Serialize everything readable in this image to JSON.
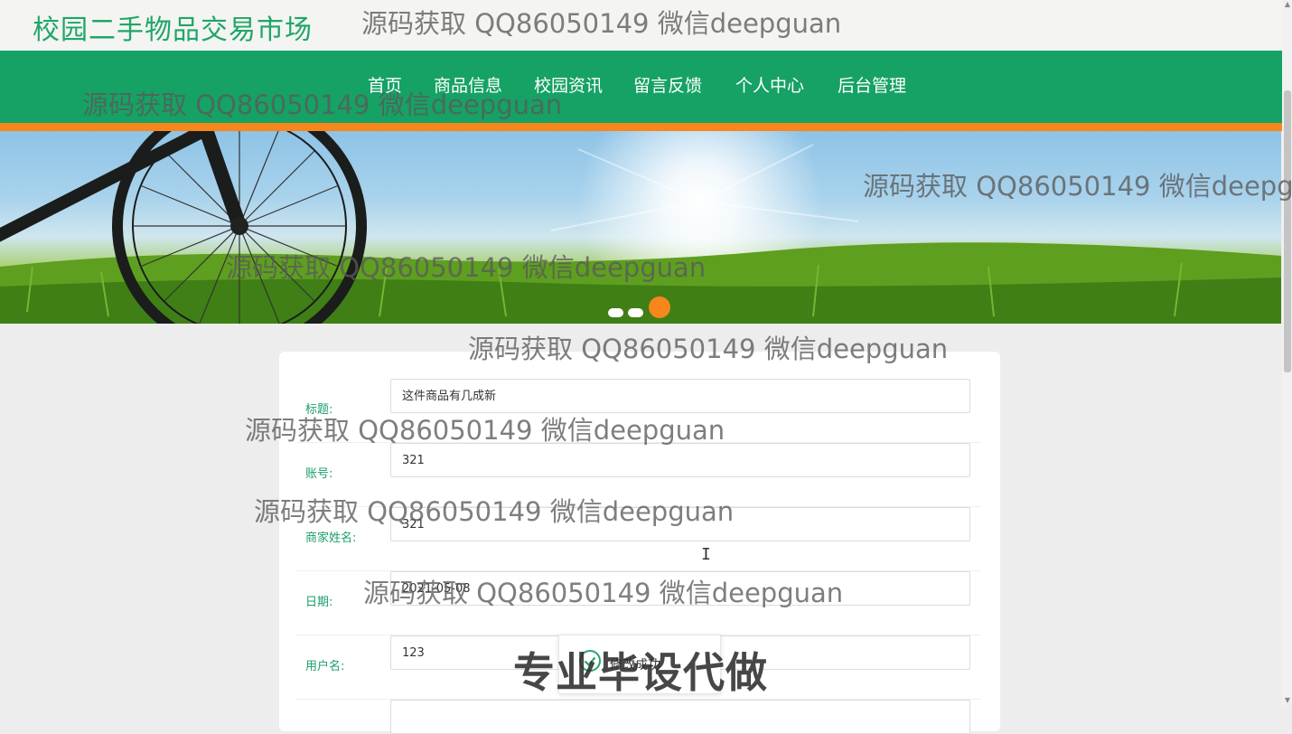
{
  "header": {
    "site_title": "校园二手物品交易市场"
  },
  "nav": {
    "items": [
      "首页",
      "商品信息",
      "校园资讯",
      "留言反馈",
      "个人中心",
      "后台管理"
    ]
  },
  "banner": {
    "active_slide": 3,
    "slide_count": 3
  },
  "form": {
    "rows": [
      {
        "label": "标题:",
        "value": "这件商品有几成新"
      },
      {
        "label": "账号:",
        "value": "321"
      },
      {
        "label": "商家姓名:",
        "value": "321"
      },
      {
        "label": "日期:",
        "value": "2021-05-08"
      },
      {
        "label": "用户名:",
        "value": "123"
      }
    ]
  },
  "toast": {
    "text": "修改成功"
  },
  "watermarks": {
    "contact": "源码获取 QQ86050149 微信deepguan",
    "service": "专业毕设代做"
  },
  "colors": {
    "primary": "#16a265",
    "accent": "#f7861c",
    "label": "#1b9e6a"
  }
}
